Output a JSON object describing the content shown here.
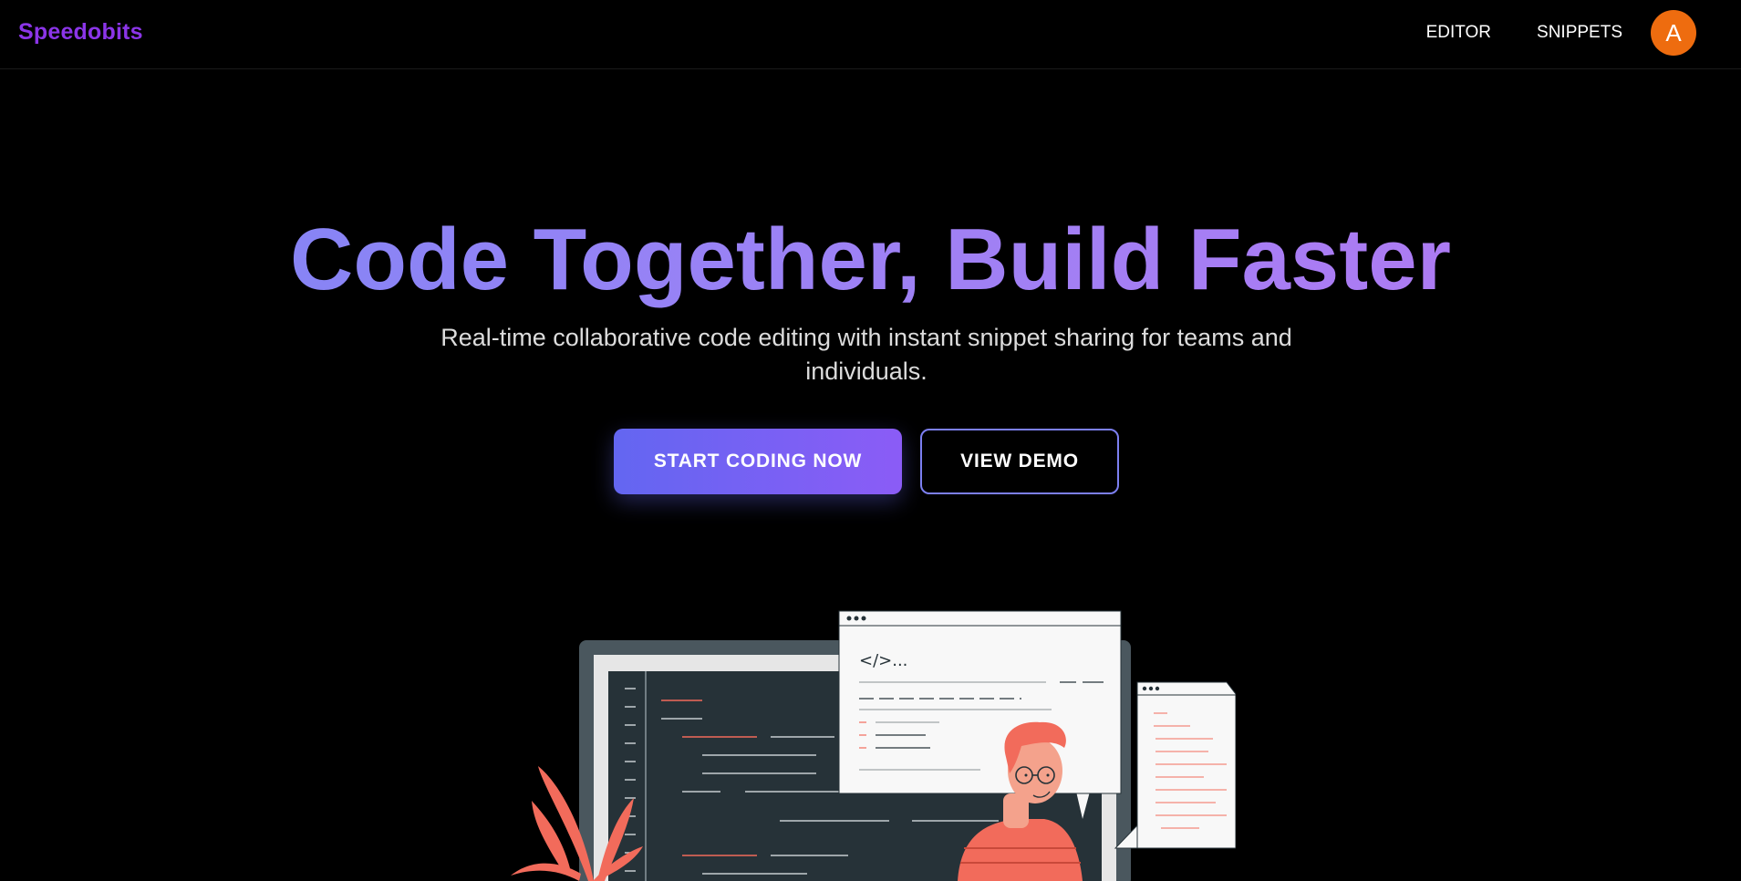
{
  "navbar": {
    "brand": "Speedobits",
    "links": [
      "EDITOR",
      "SNIPPETS"
    ],
    "avatar_initial": "A"
  },
  "hero": {
    "title": "Code Together, Build Faster",
    "subtitle": "Real-time collaborative code editing with instant snippet sharing for teams and individuals.",
    "primary_button": "START CODING NOW",
    "secondary_button": "VIEW DEMO"
  },
  "illustration": {
    "code_tag": "</>..."
  },
  "colors": {
    "brand": "#8b35e8",
    "avatar": "#ee6c0f",
    "accent_start": "#6366f1",
    "accent_end": "#8b5cf6",
    "illustration_accent": "#f26b5b"
  }
}
